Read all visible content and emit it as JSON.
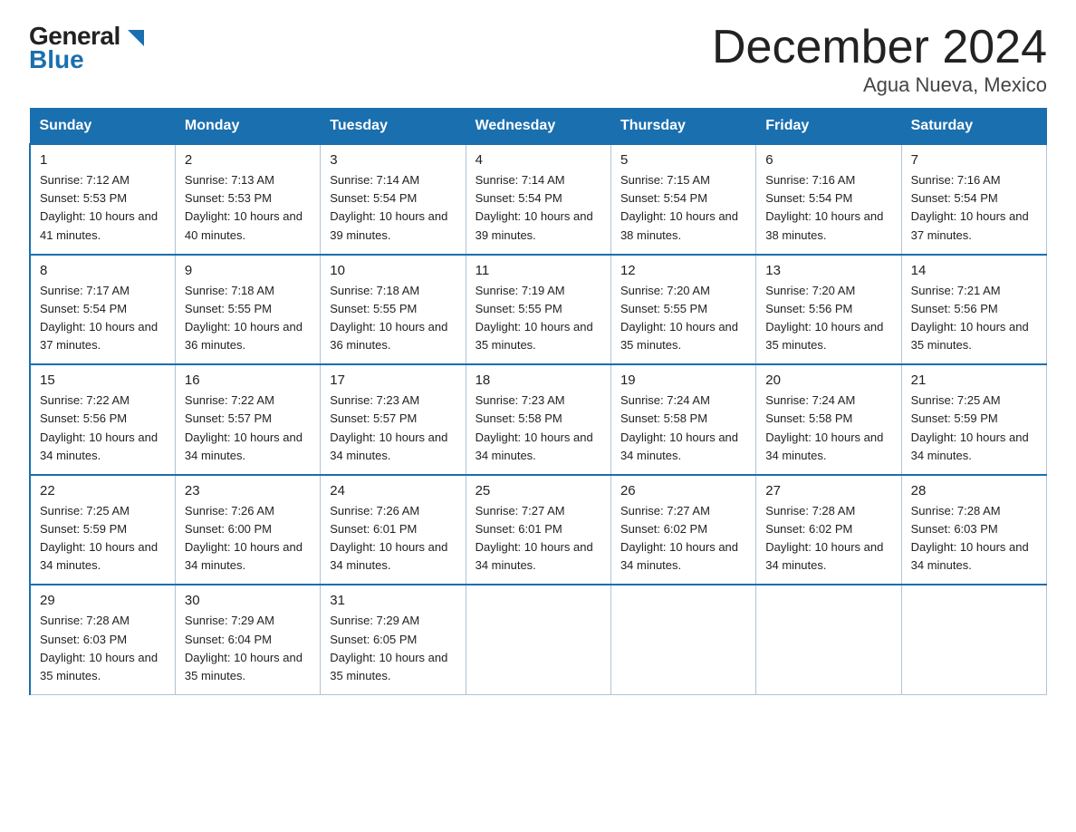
{
  "header": {
    "title": "December 2024",
    "subtitle": "Agua Nueva, Mexico",
    "logo_line1": "General",
    "logo_line2": "Blue"
  },
  "days_of_week": [
    "Sunday",
    "Monday",
    "Tuesday",
    "Wednesday",
    "Thursday",
    "Friday",
    "Saturday"
  ],
  "weeks": [
    [
      {
        "day": "1",
        "sunrise": "7:12 AM",
        "sunset": "5:53 PM",
        "daylight": "10 hours and 41 minutes."
      },
      {
        "day": "2",
        "sunrise": "7:13 AM",
        "sunset": "5:53 PM",
        "daylight": "10 hours and 40 minutes."
      },
      {
        "day": "3",
        "sunrise": "7:14 AM",
        "sunset": "5:54 PM",
        "daylight": "10 hours and 39 minutes."
      },
      {
        "day": "4",
        "sunrise": "7:14 AM",
        "sunset": "5:54 PM",
        "daylight": "10 hours and 39 minutes."
      },
      {
        "day": "5",
        "sunrise": "7:15 AM",
        "sunset": "5:54 PM",
        "daylight": "10 hours and 38 minutes."
      },
      {
        "day": "6",
        "sunrise": "7:16 AM",
        "sunset": "5:54 PM",
        "daylight": "10 hours and 38 minutes."
      },
      {
        "day": "7",
        "sunrise": "7:16 AM",
        "sunset": "5:54 PM",
        "daylight": "10 hours and 37 minutes."
      }
    ],
    [
      {
        "day": "8",
        "sunrise": "7:17 AM",
        "sunset": "5:54 PM",
        "daylight": "10 hours and 37 minutes."
      },
      {
        "day": "9",
        "sunrise": "7:18 AM",
        "sunset": "5:55 PM",
        "daylight": "10 hours and 36 minutes."
      },
      {
        "day": "10",
        "sunrise": "7:18 AM",
        "sunset": "5:55 PM",
        "daylight": "10 hours and 36 minutes."
      },
      {
        "day": "11",
        "sunrise": "7:19 AM",
        "sunset": "5:55 PM",
        "daylight": "10 hours and 35 minutes."
      },
      {
        "day": "12",
        "sunrise": "7:20 AM",
        "sunset": "5:55 PM",
        "daylight": "10 hours and 35 minutes."
      },
      {
        "day": "13",
        "sunrise": "7:20 AM",
        "sunset": "5:56 PM",
        "daylight": "10 hours and 35 minutes."
      },
      {
        "day": "14",
        "sunrise": "7:21 AM",
        "sunset": "5:56 PM",
        "daylight": "10 hours and 35 minutes."
      }
    ],
    [
      {
        "day": "15",
        "sunrise": "7:22 AM",
        "sunset": "5:56 PM",
        "daylight": "10 hours and 34 minutes."
      },
      {
        "day": "16",
        "sunrise": "7:22 AM",
        "sunset": "5:57 PM",
        "daylight": "10 hours and 34 minutes."
      },
      {
        "day": "17",
        "sunrise": "7:23 AM",
        "sunset": "5:57 PM",
        "daylight": "10 hours and 34 minutes."
      },
      {
        "day": "18",
        "sunrise": "7:23 AM",
        "sunset": "5:58 PM",
        "daylight": "10 hours and 34 minutes."
      },
      {
        "day": "19",
        "sunrise": "7:24 AM",
        "sunset": "5:58 PM",
        "daylight": "10 hours and 34 minutes."
      },
      {
        "day": "20",
        "sunrise": "7:24 AM",
        "sunset": "5:58 PM",
        "daylight": "10 hours and 34 minutes."
      },
      {
        "day": "21",
        "sunrise": "7:25 AM",
        "sunset": "5:59 PM",
        "daylight": "10 hours and 34 minutes."
      }
    ],
    [
      {
        "day": "22",
        "sunrise": "7:25 AM",
        "sunset": "5:59 PM",
        "daylight": "10 hours and 34 minutes."
      },
      {
        "day": "23",
        "sunrise": "7:26 AM",
        "sunset": "6:00 PM",
        "daylight": "10 hours and 34 minutes."
      },
      {
        "day": "24",
        "sunrise": "7:26 AM",
        "sunset": "6:01 PM",
        "daylight": "10 hours and 34 minutes."
      },
      {
        "day": "25",
        "sunrise": "7:27 AM",
        "sunset": "6:01 PM",
        "daylight": "10 hours and 34 minutes."
      },
      {
        "day": "26",
        "sunrise": "7:27 AM",
        "sunset": "6:02 PM",
        "daylight": "10 hours and 34 minutes."
      },
      {
        "day": "27",
        "sunrise": "7:28 AM",
        "sunset": "6:02 PM",
        "daylight": "10 hours and 34 minutes."
      },
      {
        "day": "28",
        "sunrise": "7:28 AM",
        "sunset": "6:03 PM",
        "daylight": "10 hours and 34 minutes."
      }
    ],
    [
      {
        "day": "29",
        "sunrise": "7:28 AM",
        "sunset": "6:03 PM",
        "daylight": "10 hours and 35 minutes."
      },
      {
        "day": "30",
        "sunrise": "7:29 AM",
        "sunset": "6:04 PM",
        "daylight": "10 hours and 35 minutes."
      },
      {
        "day": "31",
        "sunrise": "7:29 AM",
        "sunset": "6:05 PM",
        "daylight": "10 hours and 35 minutes."
      },
      null,
      null,
      null,
      null
    ]
  ]
}
